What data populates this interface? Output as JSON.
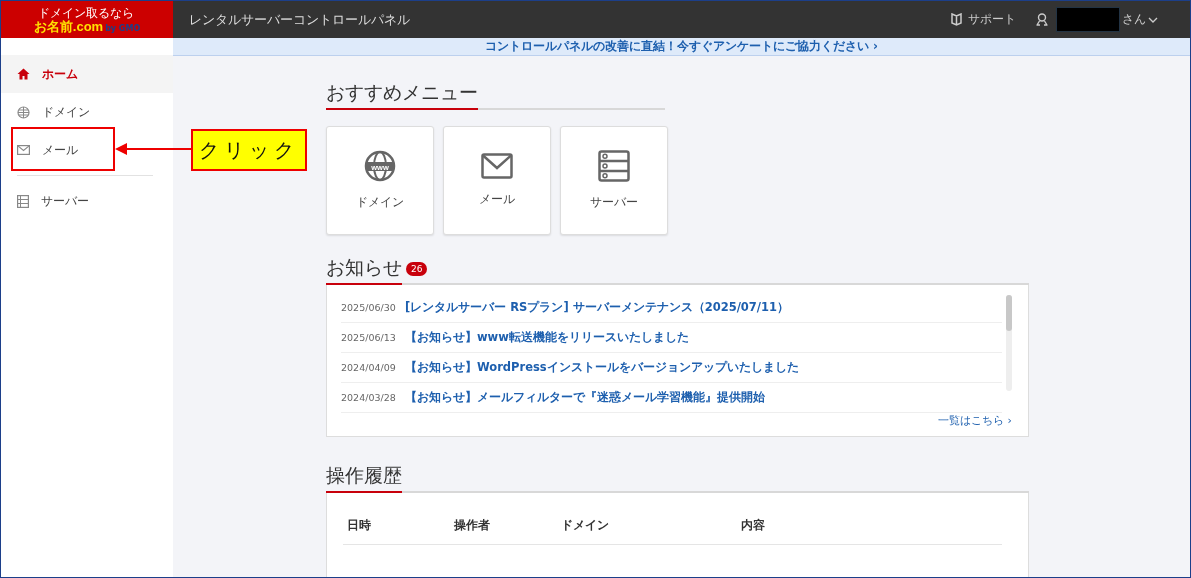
{
  "header": {
    "logo": {
      "tagline": "ドメイン取るなら",
      "name": "お名前.com",
      "by": "by GMO"
    },
    "title": "レンタルサーバーコントロールパネル",
    "support": "サポート",
    "user_suffix": "さん"
  },
  "sidebar": {
    "items": [
      {
        "label": "ホーム",
        "kind": "home",
        "selected": true
      },
      {
        "label": "ドメイン",
        "kind": "globe",
        "selected": false
      },
      {
        "label": "メール",
        "kind": "mail",
        "selected": false
      },
      {
        "label": "サーバー",
        "kind": "server",
        "selected": false
      }
    ]
  },
  "banner": "コントロールパネルの改善に直結！今すぐアンケートにご協力ください ›",
  "annotation": {
    "label": "クリック"
  },
  "recommended": {
    "title": "おすすめメニュー",
    "items": [
      {
        "label": "ドメイン",
        "kind": "globe",
        "icon_text": "www"
      },
      {
        "label": "メール",
        "kind": "mail"
      },
      {
        "label": "サーバー",
        "kind": "server"
      }
    ]
  },
  "news": {
    "title": "お知らせ",
    "count": "26",
    "items": [
      {
        "date": "2025/06/30",
        "text": "[レンタルサーバー RSプラン] サーバーメンテナンス（2025/07/11）"
      },
      {
        "date": "2025/06/13",
        "text": "【お知らせ】www転送機能をリリースいたしました"
      },
      {
        "date": "2024/04/09",
        "text": "【お知らせ】WordPressインストールをバージョンアップいたしました"
      },
      {
        "date": "2024/03/28",
        "text": "【お知らせ】メールフィルターで『迷惑メール学習機能』提供開始"
      }
    ],
    "more": "一覧はこちら ›"
  },
  "history": {
    "title": "操作履歴",
    "columns": [
      "日時",
      "操作者",
      "ドメイン",
      "内容"
    ]
  }
}
